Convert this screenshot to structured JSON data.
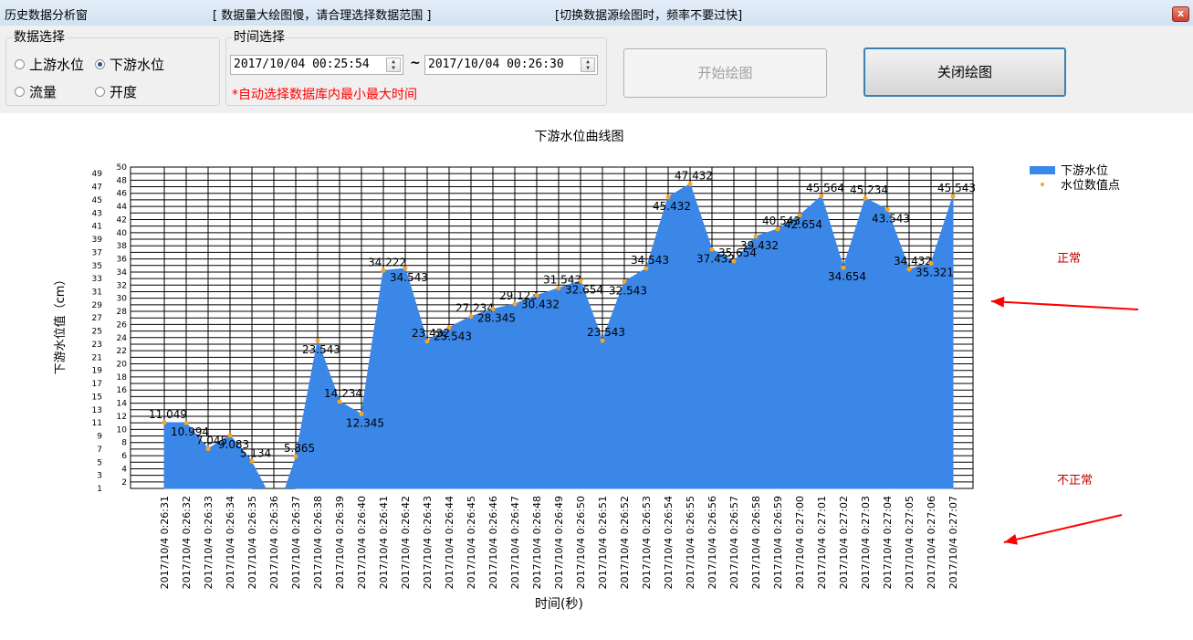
{
  "window": {
    "title": "历史数据分析窗",
    "notice1": "[ 数据量大绘图慢，请合理选择数据范围 ]",
    "notice2": "[切换数据源绘图时，频率不要过快]",
    "close_glyph": "x"
  },
  "data_select": {
    "legend": "数据选择",
    "options": [
      {
        "label": "上游水位",
        "selected": false
      },
      {
        "label": "下游水位",
        "selected": true
      },
      {
        "label": "流量",
        "selected": false
      },
      {
        "label": "开度",
        "selected": false
      }
    ]
  },
  "time_select": {
    "legend": "时间选择",
    "start": "2017/10/04 00:25:54",
    "separator": "~",
    "end": "2017/10/04 00:26:30",
    "hint": "*自动选择数据库内最小最大时间"
  },
  "buttons": {
    "start_plot": "开始绘图",
    "close_plot": "关闭绘图"
  },
  "annotations": {
    "normal": "正常",
    "abnormal": "不正常",
    "arrow_color": "#ff0000"
  },
  "colors": {
    "area": "#3b87e8",
    "point": "#f5a623"
  },
  "chart_data": {
    "type": "area",
    "title": "下游水位曲线图",
    "xlabel": "时间(秒)",
    "ylabel": "下游水位值（cm）",
    "ylim": [
      1,
      50
    ],
    "yticks": [
      1,
      2,
      3,
      4,
      5,
      6,
      7,
      8,
      9,
      10,
      11,
      12,
      13,
      14,
      15,
      16,
      17,
      18,
      19,
      20,
      21,
      22,
      23,
      24,
      25,
      26,
      27,
      28,
      29,
      30,
      31,
      32,
      33,
      34,
      35,
      36,
      37,
      38,
      39,
      40,
      41,
      42,
      43,
      44,
      45,
      46,
      47,
      48,
      49,
      50
    ],
    "grid": true,
    "legend_position": "top-right",
    "legend": [
      {
        "name": "下游水位",
        "kind": "area"
      },
      {
        "name": "水位数值点",
        "kind": "point"
      }
    ],
    "categories": [
      "2017/10/4 0:26:31",
      "2017/10/4 0:26:32",
      "2017/10/4 0:26:33",
      "2017/10/4 0:26:34",
      "2017/10/4 0:26:35",
      "2017/10/4 0:26:36",
      "2017/10/4 0:26:37",
      "2017/10/4 0:26:38",
      "2017/10/4 0:26:39",
      "2017/10/4 0:26:40",
      "2017/10/4 0:26:41",
      "2017/10/4 0:26:42",
      "2017/10/4 0:26:43",
      "2017/10/4 0:26:44",
      "2017/10/4 0:26:45",
      "2017/10/4 0:26:46",
      "2017/10/4 0:26:47",
      "2017/10/4 0:26:48",
      "2017/10/4 0:26:49",
      "2017/10/4 0:26:50",
      "2017/10/4 0:26:51",
      "2017/10/4 0:26:52",
      "2017/10/4 0:26:53",
      "2017/10/4 0:26:54",
      "2017/10/4 0:26:55",
      "2017/10/4 0:26:56",
      "2017/10/4 0:26:57",
      "2017/10/4 0:26:58",
      "2017/10/4 0:26:59",
      "2017/10/4 0:27:00",
      "2017/10/4 0:27:01",
      "2017/10/4 0:27:02",
      "2017/10/4 0:27:03",
      "2017/10/4 0:27:04",
      "2017/10/4 0:27:05",
      "2017/10/4 0:27:06",
      "2017/10/4 0:27:07"
    ],
    "series": [
      {
        "name": "下游水位",
        "values": [
          11.049,
          10.994,
          7.045,
          9.083,
          5.134,
          null,
          5.865,
          23.543,
          14.234,
          12.345,
          34.222,
          34.543,
          23.432,
          25.543,
          27.234,
          28.345,
          29.123,
          30.432,
          31.543,
          32.654,
          23.543,
          32.543,
          34.543,
          45.432,
          47.432,
          37.432,
          35.654,
          39.432,
          40.543,
          42.654,
          45.564,
          34.654,
          45.234,
          43.543,
          34.432,
          35.321,
          45.543
        ],
        "labels": [
          "11.049",
          "10.994",
          "7.045",
          "9.083",
          "5.134",
          "",
          "5.865",
          "23.543",
          "14.234",
          "12.345",
          "34.222",
          "34.543",
          "23.432",
          "25.543",
          "27.234",
          "28.345",
          "29.123",
          "30.432",
          "31.543",
          "32.654",
          "23.543",
          "32.543",
          "34.543",
          "45.432",
          "47.432",
          "37.432",
          "35.654",
          "39.432",
          "40.543",
          "42.654",
          "45.564",
          "34.654",
          "45.234",
          "43.543",
          "34.432",
          "35.321",
          "45.543"
        ]
      }
    ]
  }
}
